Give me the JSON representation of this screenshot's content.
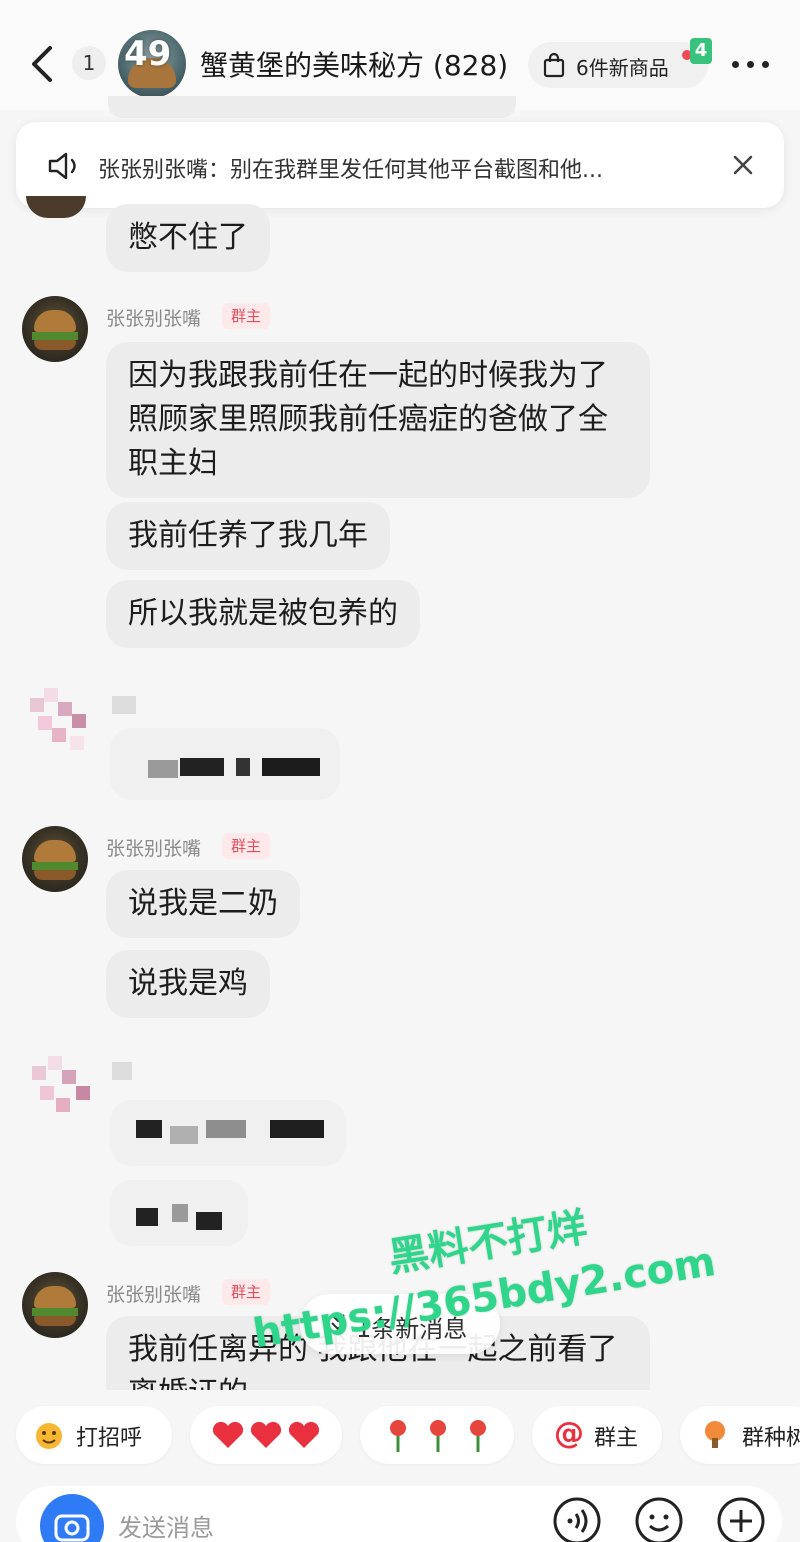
{
  "header": {
    "back_label": "",
    "unread_count": "1",
    "avatar_count": "49",
    "group_title": "蟹黄堡的美味秘方 (828)",
    "shop_label": "6件新商品",
    "shop_badge": "4"
  },
  "announcement": {
    "text": "张张别张嘴：别在我群里发任何其他平台截图和他..."
  },
  "messages": [
    {
      "text": "憋不住了"
    },
    {
      "sender": "张张别张嘴",
      "role": "群主",
      "bubbles": [
        "因为我跟我前任在一起的时候我为了照顾家里照顾我前任癌症的爸做了全职主妇",
        "我前任养了我几年",
        "所以我就是被包养的"
      ]
    },
    {
      "sender": "张张别张嘴",
      "role": "群主",
      "bubbles": [
        "说我是二奶",
        "说我是鸡"
      ]
    },
    {
      "sender": "张张别张嘴",
      "role": "群主",
      "bubbles": [
        "我前任离异的 我跟他在一起之前看了离婚证的"
      ]
    }
  ],
  "new_messages": "1条新消息",
  "watermark": {
    "line1": "黑料不打烊",
    "line2": "https://365bdy2.com"
  },
  "quick_replies": [
    {
      "icon": "wave-emoji-icon",
      "label": "打招呼"
    },
    {
      "icon": "hearts-icon",
      "label": ""
    },
    {
      "icon": "roses-icon",
      "label": ""
    },
    {
      "icon": "at-icon",
      "label": "群主"
    },
    {
      "icon": "tree-icon",
      "label": "群种树"
    }
  ],
  "input": {
    "placeholder": "发送消息"
  },
  "colors": {
    "accent_blue": "#2f7bf5",
    "owner_tag_bg": "#fde8ea",
    "owner_tag_text": "#e0505e",
    "watermark": "#2ed58b",
    "badge_green": "#38c27b"
  }
}
